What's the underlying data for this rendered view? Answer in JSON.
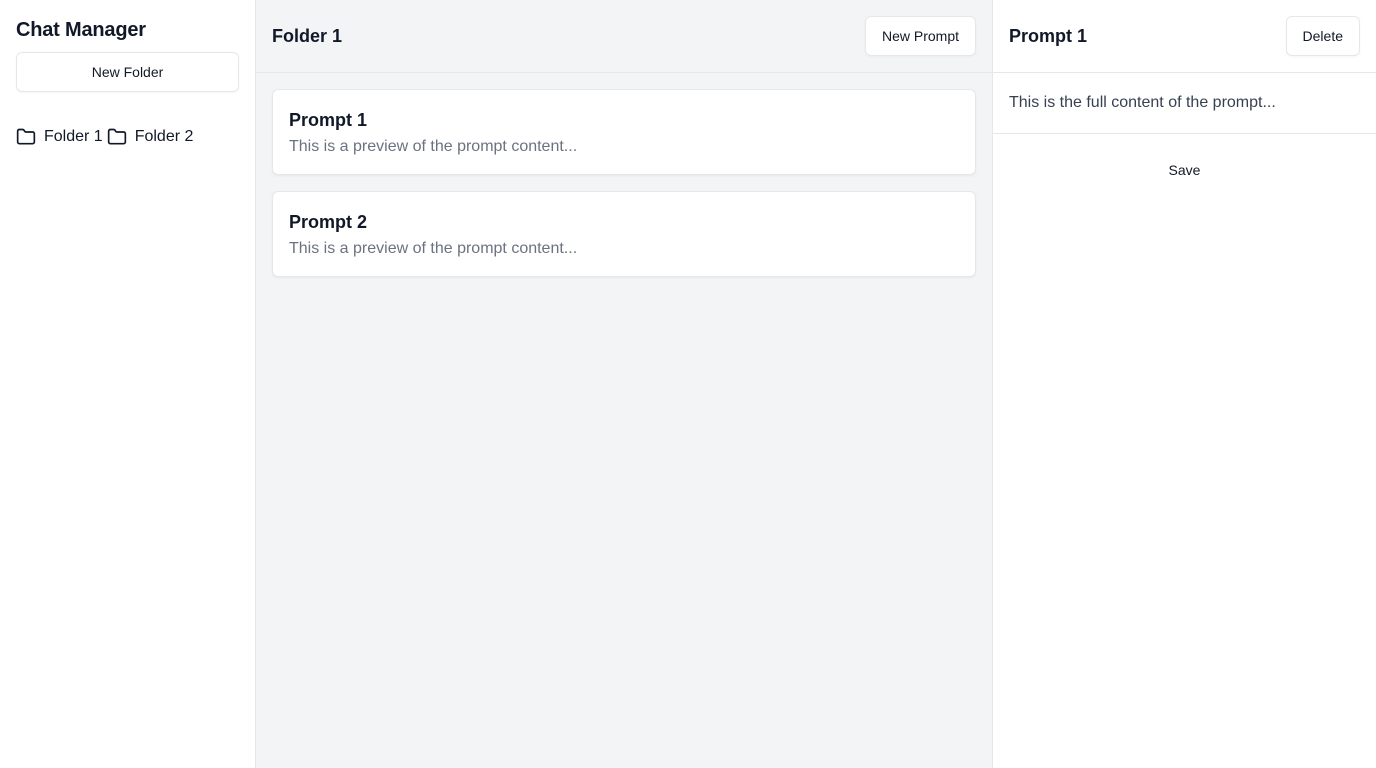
{
  "sidebar": {
    "title": "Chat Manager",
    "new_folder_label": "New Folder",
    "folders": [
      {
        "label": "Folder 1",
        "icon": "folder-icon"
      },
      {
        "label": "Folder 2",
        "icon": "folder-icon"
      }
    ]
  },
  "main": {
    "title": "Folder 1",
    "new_prompt_label": "New Prompt",
    "prompts": [
      {
        "title": "Prompt 1",
        "preview": "This is a preview of the prompt content..."
      },
      {
        "title": "Prompt 2",
        "preview": "This is a preview of the prompt content..."
      }
    ]
  },
  "detail": {
    "title": "Prompt 1",
    "delete_label": "Delete",
    "content": "This is the full content of the prompt...",
    "save_label": "Save"
  },
  "colors": {
    "border": "#e5e7eb",
    "middle_background": "#f3f4f6",
    "muted_text": "#6b7280"
  }
}
